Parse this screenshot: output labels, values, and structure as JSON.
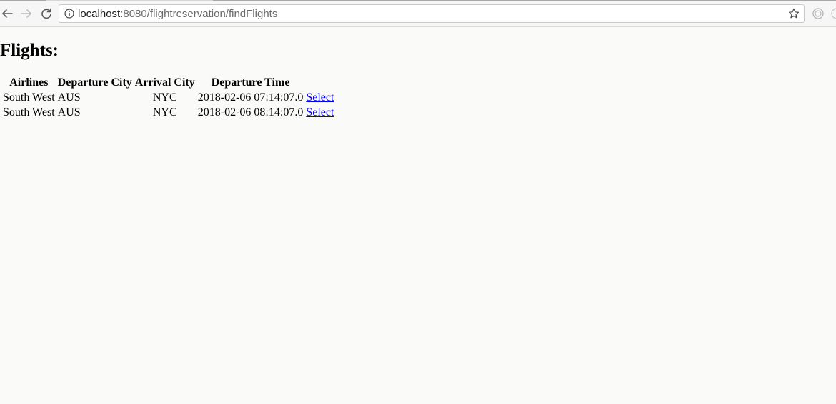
{
  "browser": {
    "url_host": "localhost",
    "url_path": ":8080/flightreservation/findFlights"
  },
  "page": {
    "title": "Flights:"
  },
  "table": {
    "headers": [
      "Airlines",
      "Departure City",
      "Arrival City",
      "Departure Time"
    ],
    "rows": [
      {
        "airline": "South West",
        "departure_city": "AUS",
        "arrival_city": "NYC",
        "departure_time": "2018-02-06 07:14:07.0",
        "action": "Select"
      },
      {
        "airline": "South West",
        "departure_city": "AUS",
        "arrival_city": "NYC",
        "departure_time": "2018-02-06 08:14:07.0",
        "action": "Select"
      }
    ]
  },
  "icons": {
    "back": "arrow-left-icon",
    "forward": "arrow-right-icon",
    "reload": "reload-icon",
    "info": "info-icon",
    "bookmark": "star-icon",
    "extension": "extension-icon"
  },
  "colors": {
    "link": "#0000ee",
    "page_background": "#fafaf9"
  }
}
